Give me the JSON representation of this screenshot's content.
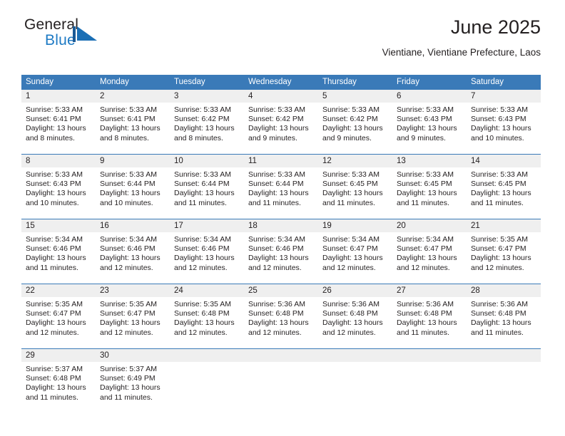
{
  "brand": {
    "name_top": "General",
    "name_bottom": "Blue",
    "logo_color": "#1e7ac4"
  },
  "header": {
    "title": "June 2025",
    "subtitle": "Vientiane, Vientiane Prefecture, Laos"
  },
  "theme": {
    "header_blue": "#3a7ab8",
    "daynum_band": "#efefef",
    "text": "#231f20"
  },
  "weekdays": [
    "Sunday",
    "Monday",
    "Tuesday",
    "Wednesday",
    "Thursday",
    "Friday",
    "Saturday"
  ],
  "weeks": [
    [
      {
        "day": "1",
        "sunrise": "Sunrise: 5:33 AM",
        "sunset": "Sunset: 6:41 PM",
        "daylight_1": "Daylight: 13 hours",
        "daylight_2": "and 8 minutes."
      },
      {
        "day": "2",
        "sunrise": "Sunrise: 5:33 AM",
        "sunset": "Sunset: 6:41 PM",
        "daylight_1": "Daylight: 13 hours",
        "daylight_2": "and 8 minutes."
      },
      {
        "day": "3",
        "sunrise": "Sunrise: 5:33 AM",
        "sunset": "Sunset: 6:42 PM",
        "daylight_1": "Daylight: 13 hours",
        "daylight_2": "and 8 minutes."
      },
      {
        "day": "4",
        "sunrise": "Sunrise: 5:33 AM",
        "sunset": "Sunset: 6:42 PM",
        "daylight_1": "Daylight: 13 hours",
        "daylight_2": "and 9 minutes."
      },
      {
        "day": "5",
        "sunrise": "Sunrise: 5:33 AM",
        "sunset": "Sunset: 6:42 PM",
        "daylight_1": "Daylight: 13 hours",
        "daylight_2": "and 9 minutes."
      },
      {
        "day": "6",
        "sunrise": "Sunrise: 5:33 AM",
        "sunset": "Sunset: 6:43 PM",
        "daylight_1": "Daylight: 13 hours",
        "daylight_2": "and 9 minutes."
      },
      {
        "day": "7",
        "sunrise": "Sunrise: 5:33 AM",
        "sunset": "Sunset: 6:43 PM",
        "daylight_1": "Daylight: 13 hours",
        "daylight_2": "and 10 minutes."
      }
    ],
    [
      {
        "day": "8",
        "sunrise": "Sunrise: 5:33 AM",
        "sunset": "Sunset: 6:43 PM",
        "daylight_1": "Daylight: 13 hours",
        "daylight_2": "and 10 minutes."
      },
      {
        "day": "9",
        "sunrise": "Sunrise: 5:33 AM",
        "sunset": "Sunset: 6:44 PM",
        "daylight_1": "Daylight: 13 hours",
        "daylight_2": "and 10 minutes."
      },
      {
        "day": "10",
        "sunrise": "Sunrise: 5:33 AM",
        "sunset": "Sunset: 6:44 PM",
        "daylight_1": "Daylight: 13 hours",
        "daylight_2": "and 11 minutes."
      },
      {
        "day": "11",
        "sunrise": "Sunrise: 5:33 AM",
        "sunset": "Sunset: 6:44 PM",
        "daylight_1": "Daylight: 13 hours",
        "daylight_2": "and 11 minutes."
      },
      {
        "day": "12",
        "sunrise": "Sunrise: 5:33 AM",
        "sunset": "Sunset: 6:45 PM",
        "daylight_1": "Daylight: 13 hours",
        "daylight_2": "and 11 minutes."
      },
      {
        "day": "13",
        "sunrise": "Sunrise: 5:33 AM",
        "sunset": "Sunset: 6:45 PM",
        "daylight_1": "Daylight: 13 hours",
        "daylight_2": "and 11 minutes."
      },
      {
        "day": "14",
        "sunrise": "Sunrise: 5:33 AM",
        "sunset": "Sunset: 6:45 PM",
        "daylight_1": "Daylight: 13 hours",
        "daylight_2": "and 11 minutes."
      }
    ],
    [
      {
        "day": "15",
        "sunrise": "Sunrise: 5:34 AM",
        "sunset": "Sunset: 6:46 PM",
        "daylight_1": "Daylight: 13 hours",
        "daylight_2": "and 11 minutes."
      },
      {
        "day": "16",
        "sunrise": "Sunrise: 5:34 AM",
        "sunset": "Sunset: 6:46 PM",
        "daylight_1": "Daylight: 13 hours",
        "daylight_2": "and 12 minutes."
      },
      {
        "day": "17",
        "sunrise": "Sunrise: 5:34 AM",
        "sunset": "Sunset: 6:46 PM",
        "daylight_1": "Daylight: 13 hours",
        "daylight_2": "and 12 minutes."
      },
      {
        "day": "18",
        "sunrise": "Sunrise: 5:34 AM",
        "sunset": "Sunset: 6:46 PM",
        "daylight_1": "Daylight: 13 hours",
        "daylight_2": "and 12 minutes."
      },
      {
        "day": "19",
        "sunrise": "Sunrise: 5:34 AM",
        "sunset": "Sunset: 6:47 PM",
        "daylight_1": "Daylight: 13 hours",
        "daylight_2": "and 12 minutes."
      },
      {
        "day": "20",
        "sunrise": "Sunrise: 5:34 AM",
        "sunset": "Sunset: 6:47 PM",
        "daylight_1": "Daylight: 13 hours",
        "daylight_2": "and 12 minutes."
      },
      {
        "day": "21",
        "sunrise": "Sunrise: 5:35 AM",
        "sunset": "Sunset: 6:47 PM",
        "daylight_1": "Daylight: 13 hours",
        "daylight_2": "and 12 minutes."
      }
    ],
    [
      {
        "day": "22",
        "sunrise": "Sunrise: 5:35 AM",
        "sunset": "Sunset: 6:47 PM",
        "daylight_1": "Daylight: 13 hours",
        "daylight_2": "and 12 minutes."
      },
      {
        "day": "23",
        "sunrise": "Sunrise: 5:35 AM",
        "sunset": "Sunset: 6:47 PM",
        "daylight_1": "Daylight: 13 hours",
        "daylight_2": "and 12 minutes."
      },
      {
        "day": "24",
        "sunrise": "Sunrise: 5:35 AM",
        "sunset": "Sunset: 6:48 PM",
        "daylight_1": "Daylight: 13 hours",
        "daylight_2": "and 12 minutes."
      },
      {
        "day": "25",
        "sunrise": "Sunrise: 5:36 AM",
        "sunset": "Sunset: 6:48 PM",
        "daylight_1": "Daylight: 13 hours",
        "daylight_2": "and 12 minutes."
      },
      {
        "day": "26",
        "sunrise": "Sunrise: 5:36 AM",
        "sunset": "Sunset: 6:48 PM",
        "daylight_1": "Daylight: 13 hours",
        "daylight_2": "and 12 minutes."
      },
      {
        "day": "27",
        "sunrise": "Sunrise: 5:36 AM",
        "sunset": "Sunset: 6:48 PM",
        "daylight_1": "Daylight: 13 hours",
        "daylight_2": "and 11 minutes."
      },
      {
        "day": "28",
        "sunrise": "Sunrise: 5:36 AM",
        "sunset": "Sunset: 6:48 PM",
        "daylight_1": "Daylight: 13 hours",
        "daylight_2": "and 11 minutes."
      }
    ],
    [
      {
        "day": "29",
        "sunrise": "Sunrise: 5:37 AM",
        "sunset": "Sunset: 6:48 PM",
        "daylight_1": "Daylight: 13 hours",
        "daylight_2": "and 11 minutes."
      },
      {
        "day": "30",
        "sunrise": "Sunrise: 5:37 AM",
        "sunset": "Sunset: 6:49 PM",
        "daylight_1": "Daylight: 13 hours",
        "daylight_2": "and 11 minutes."
      },
      {
        "day": "",
        "sunrise": "",
        "sunset": "",
        "daylight_1": "",
        "daylight_2": ""
      },
      {
        "day": "",
        "sunrise": "",
        "sunset": "",
        "daylight_1": "",
        "daylight_2": ""
      },
      {
        "day": "",
        "sunrise": "",
        "sunset": "",
        "daylight_1": "",
        "daylight_2": ""
      },
      {
        "day": "",
        "sunrise": "",
        "sunset": "",
        "daylight_1": "",
        "daylight_2": ""
      },
      {
        "day": "",
        "sunrise": "",
        "sunset": "",
        "daylight_1": "",
        "daylight_2": ""
      }
    ]
  ]
}
